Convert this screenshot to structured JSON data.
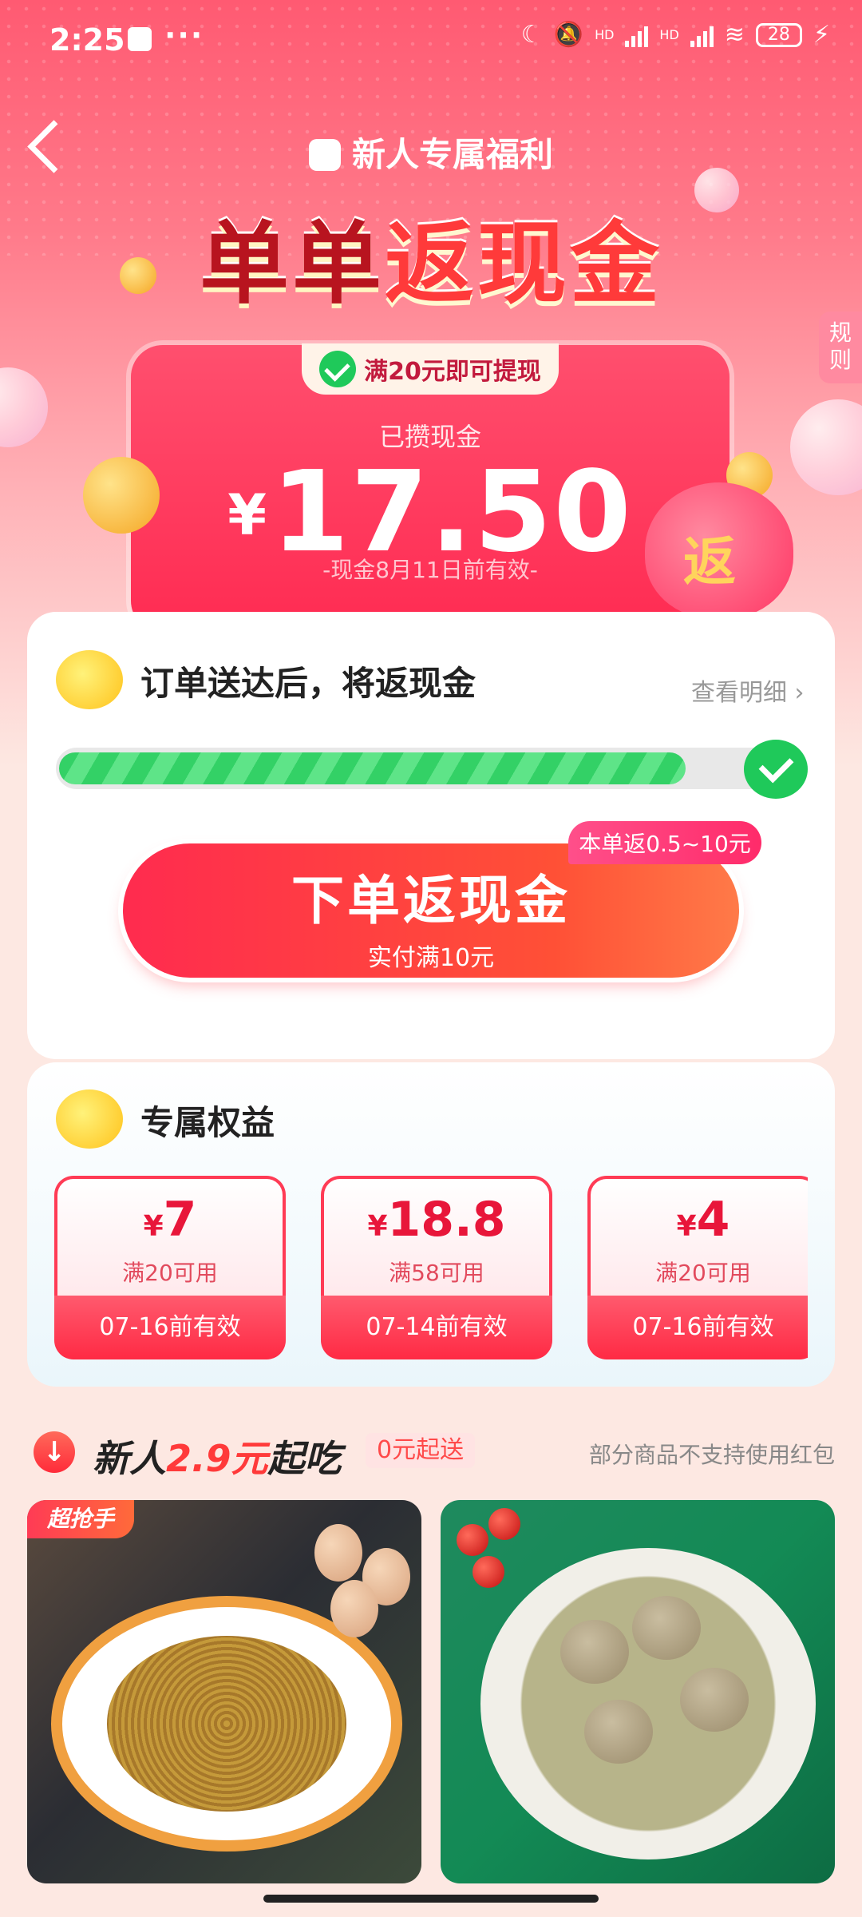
{
  "status_bar": {
    "time": "2:25",
    "dots": "···",
    "hd1": "HD",
    "hd2": "HD",
    "battery": "28"
  },
  "header": {
    "brand": "新人专属福利",
    "title_part1": "单单",
    "title_part2": "返现金",
    "rules": "规则"
  },
  "cash": {
    "pill_text": "满20元即可提现",
    "label": "已攒现金",
    "currency": "¥",
    "amount": "17.50",
    "validity": "-现金8月11日前有效-",
    "bag_char": "返"
  },
  "progress_section": {
    "title": "订单送达后，将返现金",
    "detail_link": "查看明细",
    "progress": 0.85,
    "tag": "本单返0.5~10元",
    "button_label": "下单返现金",
    "button_sub": "实付满10元"
  },
  "benefits": {
    "title": "专属权益",
    "coupons": [
      {
        "currency": "¥",
        "value": "7",
        "condition": "满20可用",
        "expiry": "07-16前有效"
      },
      {
        "currency": "¥",
        "value": "18.8",
        "condition": "满58可用",
        "expiry": "07-14前有效"
      },
      {
        "currency": "¥",
        "value": "4",
        "condition": "满20可用",
        "expiry": "07-16前有效"
      }
    ]
  },
  "newbie": {
    "title_a": "新人",
    "title_b": "2.9元",
    "title_c": "起吃",
    "badge": "0元起送",
    "note": "部分商品不支持使用红包",
    "food_tag": "超抢手"
  },
  "colors": {
    "primary": "#ff2b52",
    "green": "#1fc95a",
    "bg": "#fde8e2"
  }
}
